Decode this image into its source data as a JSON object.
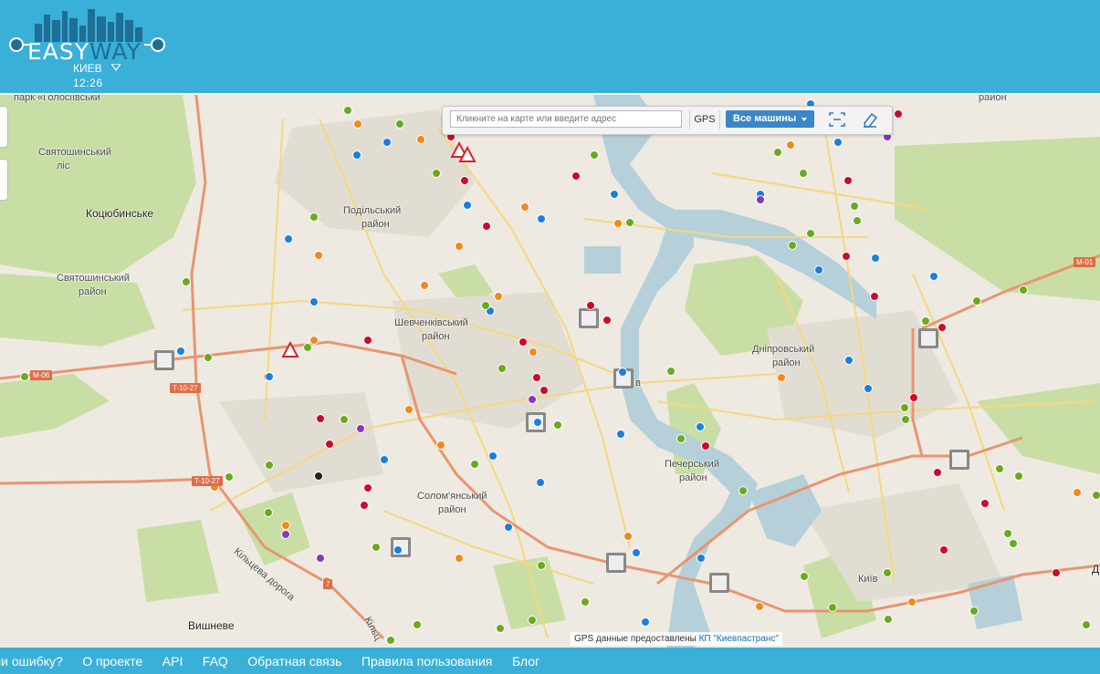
{
  "header": {
    "logo_text_a": "EASY",
    "logo_text_b": "WAY",
    "city": "КИЕВ",
    "time": "12:26"
  },
  "toolbar": {
    "search_placeholder": "Кликните на карте или введите адрес",
    "gps_label": "GPS",
    "vehicles_dropdown": "Все машины",
    "fit_icon": "fit-bounds-icon",
    "eraser_icon": "eraser-icon"
  },
  "map_labels": {
    "park": "парк «Голосіївськи",
    "svyatoshynsky_forest_1": "Святошинський",
    "svyatoshynsky_forest_2": "ліс",
    "kotsiubynske": "Коцюбинське",
    "svyatoshynsky_1": "Святошинський",
    "svyatoshynsky_2": "район",
    "podilsky_1": "Подільський",
    "podilsky_2": "район",
    "shevchenkivsky_1": "Шевченківський",
    "shevchenkivsky_2": "район",
    "dniprovsky_1": "Дніпровський",
    "dniprovsky_2": "район",
    "pechersky_1": "Печерський",
    "pechersky_2": "район",
    "solomyansky_1": "Солом'янський",
    "solomyansky_2": "район",
    "raion_top": "район",
    "kyiv": "Київ",
    "vyshneve": "Вишневе",
    "ring_road": "Кільцева дорога",
    "ring_road_2": "Кільц",
    "v_suffix": "в",
    "d_edge": "Д"
  },
  "road_badges": {
    "m06": "M-06",
    "t1027a": "T-10-27",
    "t1027b": "T-10-27",
    "m01": "M-01",
    "seven": "7"
  },
  "attribution": {
    "text": "GPS данные предоставлены",
    "link": "КП \"Киевпастранс\""
  },
  "footer": {
    "links": [
      "ли ошибку?",
      "О проекте",
      "API",
      "FAQ",
      "Обратная связь",
      "Правила пользования",
      "Блог"
    ]
  },
  "colors": {
    "header": "#3ab0d8",
    "bus": "#f08a1c",
    "trolleybus": "#1a7fe0",
    "tram": "#cc0a2e",
    "marshrutka": "#6aaa1e",
    "other": "#8b36c0"
  }
}
